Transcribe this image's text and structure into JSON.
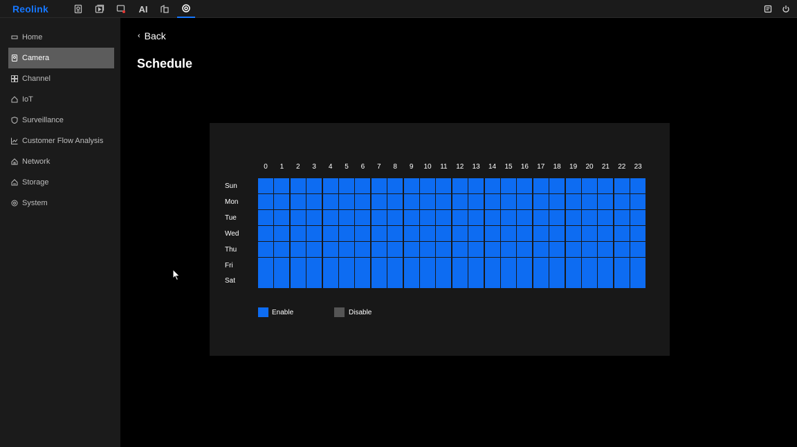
{
  "topbar": {
    "logo": "Reolink",
    "nav": [
      {
        "name": "camera-tab",
        "icon": "camera-icon"
      },
      {
        "name": "playback-tab",
        "icon": "playback-icon"
      },
      {
        "name": "alarm-tab",
        "icon": "alarm-icon"
      },
      {
        "name": "ai-tab",
        "label": "AI"
      },
      {
        "name": "device-tab",
        "icon": "device-icon"
      },
      {
        "name": "settings-tab",
        "icon": "gear-icon",
        "active": true
      }
    ],
    "right": [
      {
        "name": "message-button",
        "icon": "message-icon"
      },
      {
        "name": "power-button",
        "icon": "power-icon"
      }
    ]
  },
  "sidebar": {
    "items": [
      {
        "label": "Home",
        "icon": "home-icon"
      },
      {
        "label": "Camera",
        "icon": "camera-icon",
        "active": true
      },
      {
        "label": "Channel",
        "icon": "grid-icon"
      },
      {
        "label": "IoT",
        "icon": "iot-icon"
      },
      {
        "label": "Surveillance",
        "icon": "shield-icon"
      },
      {
        "label": "Customer Flow Analysis",
        "icon": "chart-icon"
      },
      {
        "label": "Network",
        "icon": "network-icon"
      },
      {
        "label": "Storage",
        "icon": "storage-icon"
      },
      {
        "label": "System",
        "icon": "system-icon"
      }
    ]
  },
  "main": {
    "back_label": "Back",
    "title": "Schedule"
  },
  "schedule": {
    "hours": [
      "0",
      "1",
      "2",
      "3",
      "4",
      "5",
      "6",
      "7",
      "8",
      "9",
      "10",
      "11",
      "12",
      "13",
      "14",
      "15",
      "16",
      "17",
      "18",
      "19",
      "20",
      "21",
      "22",
      "23"
    ],
    "days": [
      "Sun",
      "Mon",
      "Tue",
      "Wed",
      "Thu",
      "Fri",
      "Sat"
    ],
    "enabled_all": true,
    "colors": {
      "enable": "#0d6cf2",
      "disable": "#555555"
    },
    "legend": {
      "enable": "Enable",
      "disable": "Disable"
    }
  }
}
